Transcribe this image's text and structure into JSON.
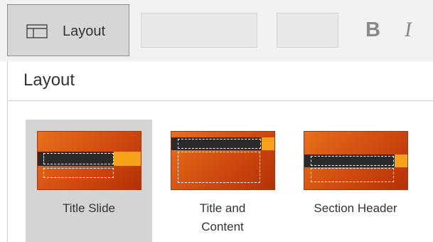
{
  "toolbar": {
    "layout_button_label": "Layout",
    "bold_label": "B",
    "italic_label": "I"
  },
  "pane": {
    "title": "Layout"
  },
  "layouts": [
    {
      "label": "Title Slide",
      "selected": true
    },
    {
      "label_line1": "Title and",
      "label_line2": "Content",
      "selected": false
    },
    {
      "label": "Section Header",
      "selected": false
    }
  ],
  "colors": {
    "accent_orange": "#f5a21a",
    "slide_orange": "#d04a10",
    "selected_bg": "#d4d4d4"
  }
}
